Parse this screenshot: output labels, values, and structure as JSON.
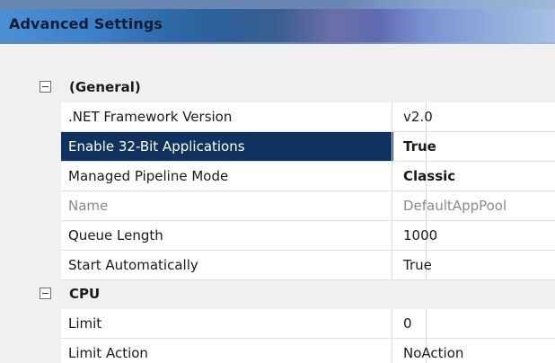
{
  "window": {
    "title": "Advanced Settings"
  },
  "categories": [
    {
      "label": "(General)",
      "rows": [
        {
          "name": ".NET Framework Version",
          "value": "v2.0"
        },
        {
          "name": "Enable 32-Bit Applications",
          "value": "True"
        },
        {
          "name": "Managed Pipeline Mode",
          "value": "Classic"
        },
        {
          "name": "Name",
          "value": "DefaultAppPool"
        },
        {
          "name": "Queue Length",
          "value": "1000"
        },
        {
          "name": "Start Automatically",
          "value": "True"
        }
      ]
    },
    {
      "label": "CPU",
      "rows": [
        {
          "name": "Limit",
          "value": "0"
        },
        {
          "name": "Limit Action",
          "value": "NoAction"
        }
      ]
    }
  ],
  "colors": {
    "selection": "#10325f",
    "category_bg": "#f0f0f0"
  },
  "icons": {
    "collapse": "collapse-minus-icon"
  }
}
